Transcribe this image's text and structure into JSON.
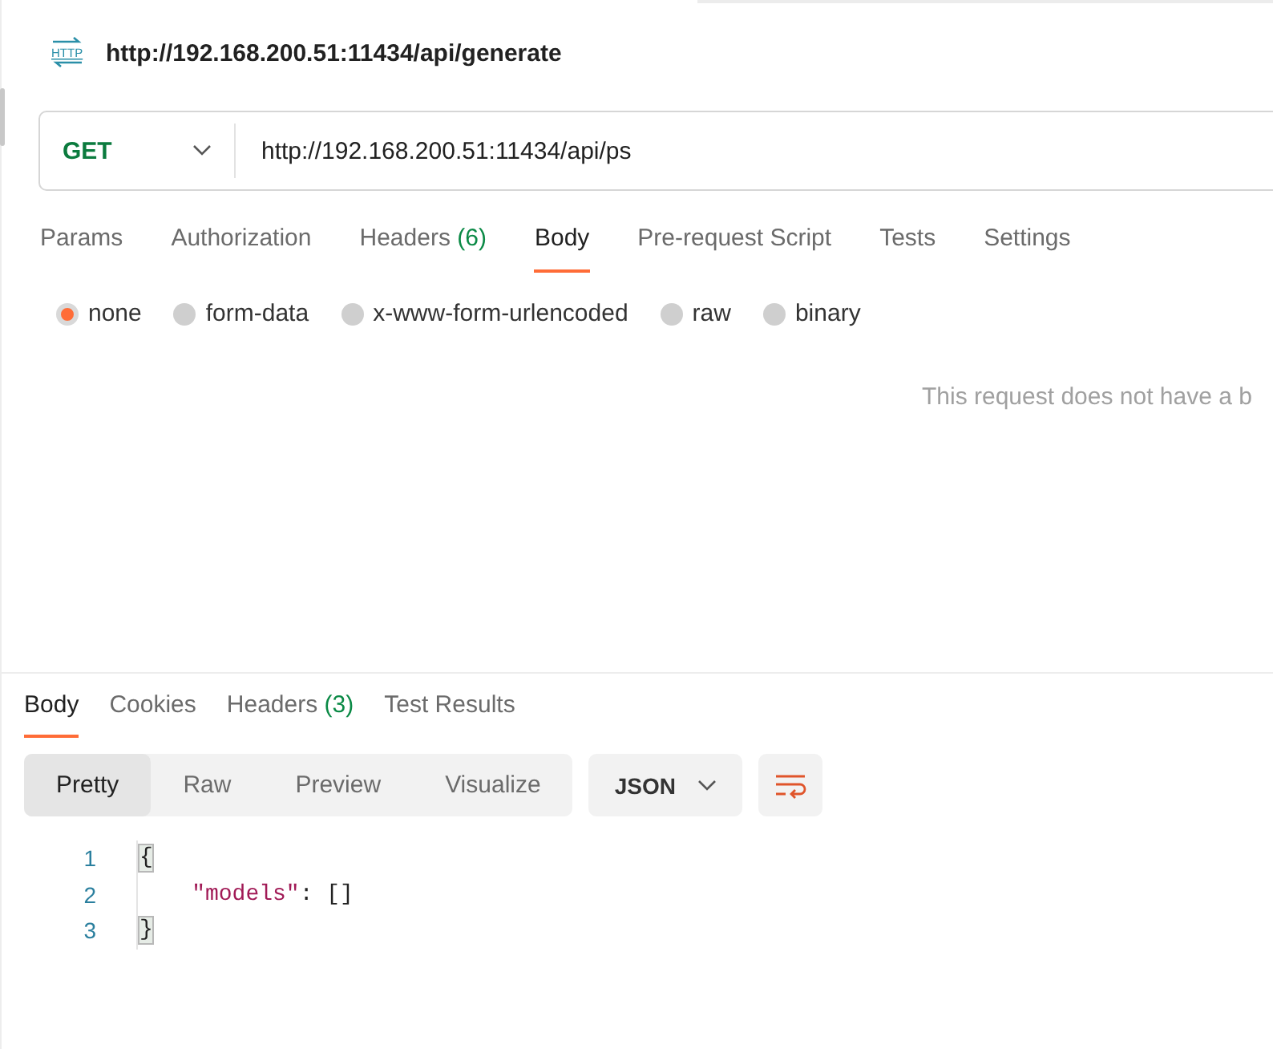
{
  "request": {
    "icon_text": "HTTP",
    "title": "http://192.168.200.51:11434/api/generate",
    "method": "GET",
    "url": "http://192.168.200.51:11434/api/ps"
  },
  "request_tabs": [
    {
      "label": "Params",
      "selected": false
    },
    {
      "label": "Authorization",
      "selected": false
    },
    {
      "label": "Headers",
      "count": "(6)",
      "selected": false
    },
    {
      "label": "Body",
      "selected": true
    },
    {
      "label": "Pre-request Script",
      "selected": false
    },
    {
      "label": "Tests",
      "selected": false
    },
    {
      "label": "Settings",
      "selected": false
    }
  ],
  "body_types": [
    {
      "label": "none",
      "selected": true
    },
    {
      "label": "form-data",
      "selected": false
    },
    {
      "label": "x-www-form-urlencoded",
      "selected": false
    },
    {
      "label": "raw",
      "selected": false
    },
    {
      "label": "binary",
      "selected": false
    }
  ],
  "body_message": "This request does not have a b",
  "response_tabs": [
    {
      "label": "Body",
      "selected": true
    },
    {
      "label": "Cookies",
      "selected": false
    },
    {
      "label": "Headers",
      "count": "(3)",
      "selected": false
    },
    {
      "label": "Test Results",
      "selected": false
    }
  ],
  "view_modes": [
    {
      "label": "Pretty",
      "selected": true
    },
    {
      "label": "Raw",
      "selected": false
    },
    {
      "label": "Preview",
      "selected": false
    },
    {
      "label": "Visualize",
      "selected": false
    }
  ],
  "format": "JSON",
  "code_lines": [
    {
      "number": "1",
      "tokens": [
        {
          "kind": "brace-match",
          "text": "{"
        }
      ]
    },
    {
      "number": "2",
      "indented": true,
      "tokens": [
        {
          "kind": "key",
          "text": "\"models\""
        },
        {
          "kind": "punct",
          "text": ": []"
        }
      ]
    },
    {
      "number": "3",
      "tokens": [
        {
          "kind": "brace-match",
          "text": "}"
        }
      ]
    }
  ]
}
